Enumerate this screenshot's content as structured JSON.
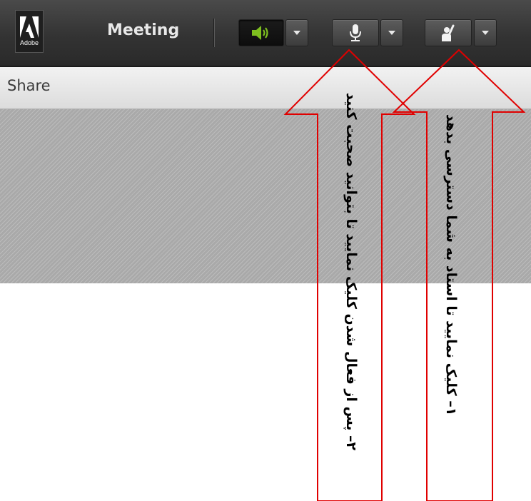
{
  "app": {
    "logo_text": "Adobe",
    "title": "Meeting"
  },
  "toolbar": {
    "speaker": {
      "icon": "speaker-icon",
      "state": "active",
      "accent": "#7ec01f"
    },
    "microphone": {
      "icon": "microphone-icon"
    },
    "raise_hand": {
      "icon": "raise-hand-icon"
    },
    "dropdown_icon": "chevron-down-icon"
  },
  "share_pod": {
    "title": "Share"
  },
  "annotations": {
    "arrow_color": "#e00000",
    "instruction_1": "۱– کلیک نمایید تا استاد به شما دسترسی بدهد",
    "instruction_2": "۲– پس از فعال شدن کلیک نمایید تا بتوانید صحبت کنید"
  }
}
